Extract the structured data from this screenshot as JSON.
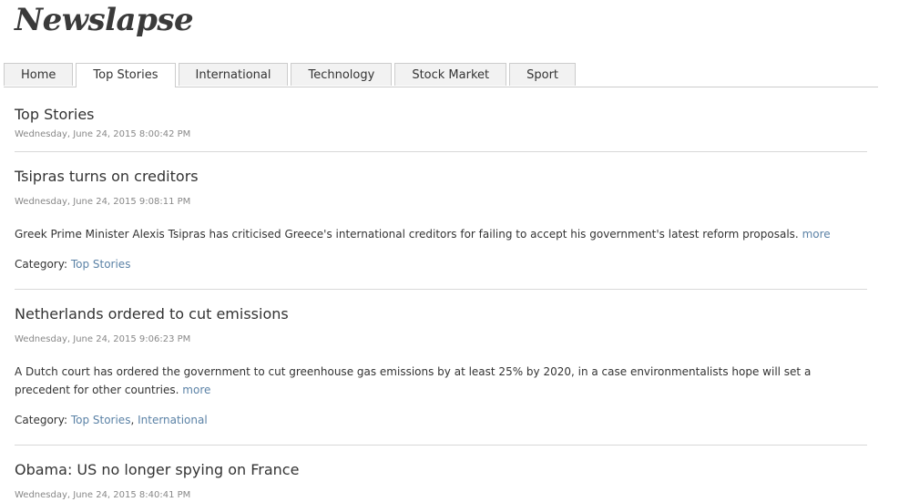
{
  "site": {
    "title": "Newslapse"
  },
  "tabs": [
    {
      "label": "Home",
      "active": false
    },
    {
      "label": "Top Stories",
      "active": true
    },
    {
      "label": "International",
      "active": false
    },
    {
      "label": "Technology",
      "active": false
    },
    {
      "label": "Stock Market",
      "active": false
    },
    {
      "label": "Sport",
      "active": false
    }
  ],
  "section": {
    "title": "Top Stories",
    "timestamp": "Wednesday, June 24, 2015 8:00:42 PM"
  },
  "category_label": "Category:",
  "more_label": "more",
  "articles": [
    {
      "title": "Tsipras turns on creditors",
      "timestamp": "Wednesday, June 24, 2015 9:08:11 PM",
      "summary": "Greek Prime Minister Alexis Tsipras has criticised Greece's international creditors for failing to accept his government's latest reform proposals.",
      "categories": [
        "Top Stories"
      ]
    },
    {
      "title": "Netherlands ordered to cut emissions",
      "timestamp": "Wednesday, June 24, 2015 9:06:23 PM",
      "summary": "A Dutch court has ordered the government to cut greenhouse gas emissions by at least 25% by 2020, in a case environmentalists hope will set a precedent for other countries.",
      "categories": [
        "Top Stories",
        "International"
      ]
    },
    {
      "title": "Obama: US no longer spying on France",
      "timestamp": "Wednesday, June 24, 2015 8:40:41 PM",
      "summary": "",
      "categories": []
    }
  ]
}
